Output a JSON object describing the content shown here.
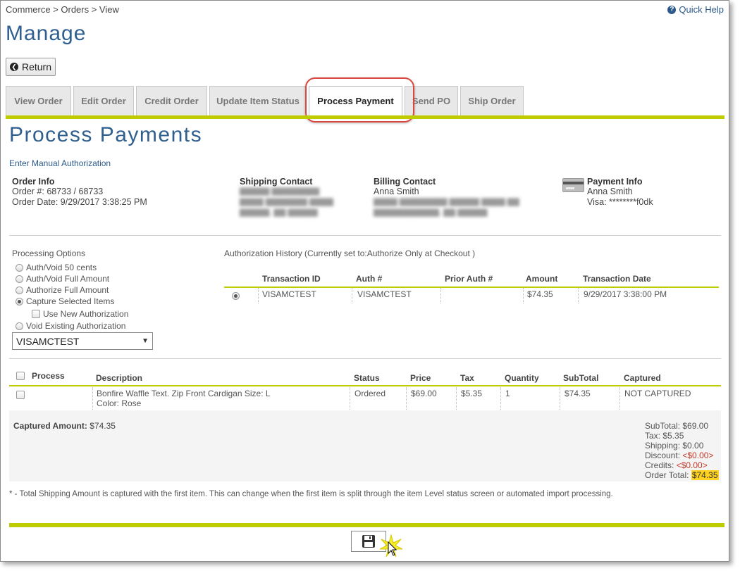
{
  "breadcrumb": "Commerce > Orders > View",
  "quick_help": "Quick Help",
  "page_title": "Manage",
  "return_label": "Return",
  "tabs": [
    {
      "label": "View Order"
    },
    {
      "label": "Edit Order"
    },
    {
      "label": "Credit Order"
    },
    {
      "label": "Update Item Status"
    },
    {
      "label": "Process Payment"
    },
    {
      "label": "Send PO"
    },
    {
      "label": "Ship Order"
    }
  ],
  "active_tab": "Process Payment",
  "section_title": "Process Payments",
  "manual_auth_link": "Enter Manual Authorization",
  "order_info": {
    "heading": "Order Info",
    "order_number": "Order #: 68733 / 68733",
    "order_date": "Order Date: 9/29/2017 3:38:25 PM"
  },
  "shipping_contact": {
    "heading": "Shipping Contact"
  },
  "billing_contact": {
    "heading": "Billing Contact",
    "name": "Anna Smith"
  },
  "payment_info": {
    "heading": "Payment Info",
    "name": "Anna Smith",
    "card": "Visa: ********f0dk"
  },
  "processing_options": {
    "heading": "Processing Options",
    "options": [
      {
        "label": "Auth/Void 50 cents",
        "checked": false
      },
      {
        "label": "Auth/Void Full Amount",
        "checked": false
      },
      {
        "label": "Authorize Full Amount",
        "checked": false
      },
      {
        "label": "Capture Selected Items",
        "checked": true
      },
      {
        "label": "Void Existing Authorization",
        "checked": false
      }
    ],
    "use_new_auth": "Use New Authorization",
    "selected_auth": "VISAMCTEST"
  },
  "auth_history": {
    "heading": "Authorization History (Currently set to:Authorize Only at Checkout )",
    "columns": [
      "Transaction ID",
      "Auth #",
      "Prior Auth #",
      "Amount",
      "Transaction Date"
    ],
    "rows": [
      {
        "transaction_id": "VISAMCTEST",
        "auth": "VISAMCTEST",
        "prior_auth": "",
        "amount": "$74.35",
        "date": "9/29/2017 3:38:00 PM"
      }
    ]
  },
  "items": {
    "columns": [
      "Process",
      "Description",
      "Status",
      "Price",
      "Tax",
      "Quantity",
      "SubTotal",
      "Captured"
    ],
    "rows": [
      {
        "description_line1": "Bonfire Waffle Text. Zip Front Cardigan Size: L",
        "description_line2": "Color: Rose",
        "status": "Ordered",
        "price": "$69.00",
        "tax": "$5.35",
        "quantity": "1",
        "subtotal": "$74.35",
        "captured": "NOT CAPTURED"
      }
    ]
  },
  "summary": {
    "captured_label": "Captured Amount:",
    "captured_value": "$74.35",
    "subtotal": "SubTotal: $69.00",
    "tax": "Tax: $5.35",
    "shipping": "Shipping: $0.00",
    "discount_label": "Discount:",
    "discount_value": "<$0.00>",
    "credits_label": "Credits:",
    "credits_value": "<$0.00>",
    "order_total_label": "Order Total:",
    "order_total_value": "$74.35"
  },
  "footnote": "* - Total Shipping Amount is captured with the first item. This can change when the first item is split through the item Level status screen or automated import processing.",
  "colors": {
    "accent_bar": "#bfcd00",
    "title_blue": "#2f5f8f",
    "highlight_ring": "#d9473e",
    "total_highlight": "#ffd21f"
  }
}
